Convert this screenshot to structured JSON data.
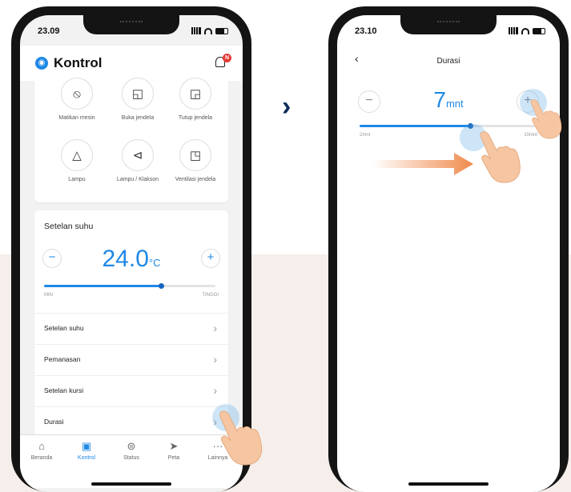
{
  "screen1": {
    "status_time": "23.09",
    "title": "Kontrol",
    "notif_count": "N",
    "controls": [
      {
        "icon": "engine-off-icon",
        "glyph": "⦸",
        "label": "Matikan mesin"
      },
      {
        "icon": "window-open-icon",
        "glyph": "◱",
        "label": "Buka jendela"
      },
      {
        "icon": "window-close-icon",
        "glyph": "◲",
        "label": "Tutup jendela"
      },
      {
        "icon": "hazard-light-icon",
        "glyph": "△",
        "label": "Lampu"
      },
      {
        "icon": "horn-icon",
        "glyph": "⊲",
        "label": "Lampu / Klakson"
      },
      {
        "icon": "window-vent-icon",
        "glyph": "◳",
        "label": "Ventilasi jendela"
      }
    ],
    "temp": {
      "title": "Setelan suhu",
      "value": "24.0",
      "unit": "°C",
      "min_label": "MIN",
      "max_label": "TINGGI",
      "level_fraction": 0.68
    },
    "menu": [
      {
        "label": "Setelan suhu"
      },
      {
        "label": "Pemanasan"
      },
      {
        "label": "Setelan kursi"
      },
      {
        "label": "Durasi"
      }
    ],
    "tabs": [
      {
        "icon": "home-icon",
        "glyph": "⌂",
        "label": "Beranda",
        "active": false
      },
      {
        "icon": "remote-icon",
        "glyph": "▣",
        "label": "Kontrol",
        "active": true
      },
      {
        "icon": "car-icon",
        "glyph": "⊜",
        "label": "Status",
        "active": false
      },
      {
        "icon": "navigation-icon",
        "glyph": "➤",
        "label": "Peta",
        "active": false
      },
      {
        "icon": "more-icon",
        "glyph": "···",
        "label": "Lainnya",
        "active": false
      }
    ]
  },
  "screen2": {
    "status_time": "23.10",
    "title": "Durasi",
    "value": "7",
    "unit": "mnt",
    "min_label": "2mnt",
    "max_label": "10mnt",
    "level_fraction": 0.62
  },
  "colors": {
    "accent": "#1e88e5",
    "arrow_orange": "#f08a4b",
    "chevron": "#0d2c5a",
    "background_band": "#f5eeea"
  }
}
